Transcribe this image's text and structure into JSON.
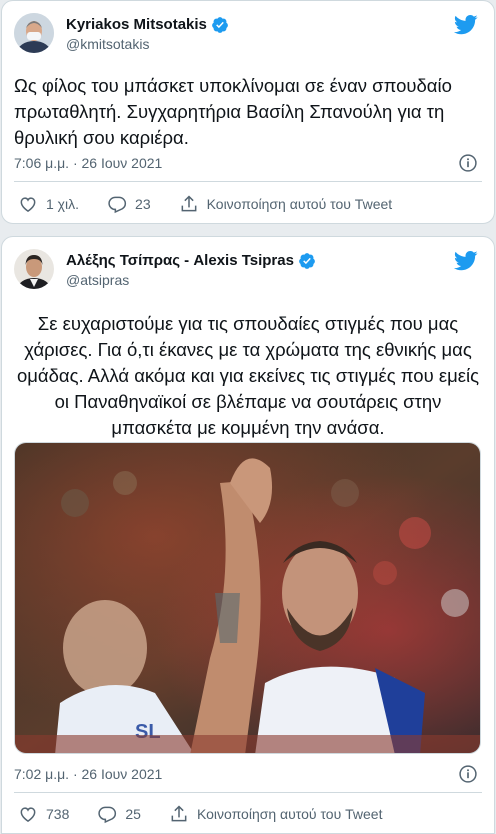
{
  "colors": {
    "accent": "#1d9bf0",
    "secondary_text": "#536471",
    "verified": "#1d9bf0"
  },
  "tweets": [
    {
      "display_name": "Kyriakos Mitsotakis",
      "handle": "@kmitsotakis",
      "verified": true,
      "text": "Ως φίλος του μπάσκετ υποκλίνομαι σε έναν σπουδαίο πρωταθλητή. Συγχαρητήρια Βασίλη Σπανούλη για τη θρυλική σου καριέρα.",
      "timestamp": "7:06 μ.μ. · 26 Ιουν 2021",
      "likes": "1 χιλ.",
      "replies": "23",
      "share_label": "Κοινοποίηση αυτού του Tweet"
    },
    {
      "display_name": "Αλέξης Τσίπρας - Alexis Tsipras",
      "handle": "@atsipras",
      "verified": true,
      "text": "Σε ευχαριστούμε για τις σπουδαίες στιγμές που μας χάρισες. Για ό,τι έκανες με τα χρώματα της εθνικής μας ομάδας. Αλλά ακόμα και για εκείνες τις στιγμές που εμείς οι Παναθηναϊκοί σε βλέπαμε να σουτάρεις στην μπασκέτα με κομμένη την ανάσα.",
      "timestamp": "7:02 μ.μ. · 26 Ιουν 2021",
      "likes": "738",
      "replies": "25",
      "share_label": "Κοινοποίηση αυτού του Tweet"
    }
  ]
}
